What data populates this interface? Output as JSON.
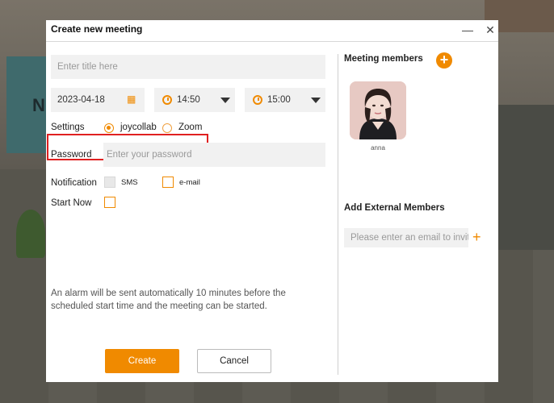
{
  "modal": {
    "title": "Create new meeting"
  },
  "form": {
    "title_placeholder": "Enter title here",
    "date": "2023-04-18",
    "start_time": "14:50",
    "end_time": "15:00",
    "settings_label": "Settings",
    "settings_options": [
      "joycollab",
      "Zoom"
    ],
    "settings_selected": "joycollab",
    "password_label": "Password",
    "password_placeholder": "Enter your password",
    "notification_label": "Notification",
    "notification_sms": "SMS",
    "notification_email": "e-mail",
    "start_now_label": "Start Now",
    "alarm_note": "An alarm will be sent automatically 10 minutes before the scheduled start time and the meeting can be started.",
    "create_label": "Create",
    "cancel_label": "Cancel"
  },
  "right": {
    "members_title": "Meeting members",
    "member_name": "anna",
    "external_title": "Add External Members",
    "email_placeholder": "Please enter an email to invite"
  },
  "colors": {
    "accent": "#f08a00",
    "highlight_box": "#e02020"
  },
  "icons": {
    "calendar": "calendar-icon",
    "clock": "clock-icon",
    "dropdown": "chevron-down-icon",
    "minimize": "minimize-icon",
    "close": "close-icon",
    "add_member": "plus-circle-icon",
    "add_email": "plus-icon"
  }
}
